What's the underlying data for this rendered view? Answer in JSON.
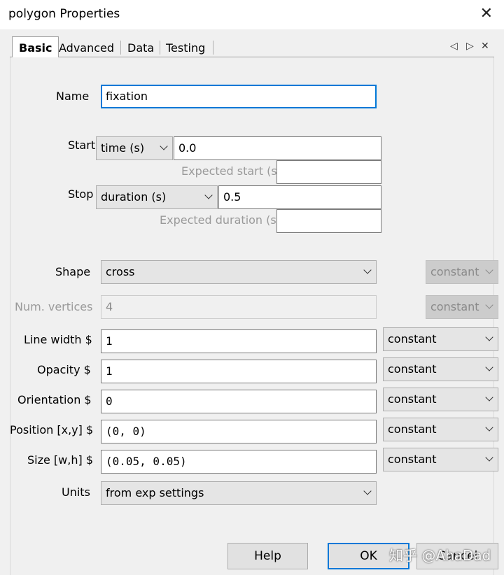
{
  "window": {
    "title": "polygon Properties",
    "close_icon": "close-icon"
  },
  "tabs": [
    {
      "label": "Basic",
      "active": true
    },
    {
      "label": "Advanced"
    },
    {
      "label": "Data"
    },
    {
      "label": "Testing"
    }
  ],
  "tab_nav": {
    "prev": "◁",
    "next": "▷",
    "close": "✕"
  },
  "name": {
    "label": "Name",
    "value": "fixation"
  },
  "start": {
    "label": "Start",
    "type": "time (s)",
    "value": "0.0",
    "expected_label": "Expected start (s)",
    "expected_value": ""
  },
  "stop": {
    "label": "Stop",
    "type": "duration (s)",
    "value": "0.5",
    "expected_label": "Expected duration (s)",
    "expected_value": ""
  },
  "shape": {
    "label": "Shape",
    "value": "cross",
    "update": "constant"
  },
  "num_vertices": {
    "label": "Num. vertices",
    "value": "4",
    "update": "constant"
  },
  "line_width": {
    "label": "Line width $",
    "value": "1",
    "update": "constant"
  },
  "opacity": {
    "label": "Opacity $",
    "value": "1",
    "update": "constant"
  },
  "orientation": {
    "label": "Orientation $",
    "value": "0",
    "update": "constant"
  },
  "position": {
    "label": "Position [x,y] $",
    "value": "(0, 0)",
    "update": "constant"
  },
  "size": {
    "label": "Size [w,h] $",
    "value": "(0.05, 0.05)",
    "update": "constant"
  },
  "units": {
    "label": "Units",
    "value": "from exp settings"
  },
  "buttons": {
    "help": "Help",
    "ok": "OK",
    "cancel": "Cancel"
  },
  "watermark": "知乎 @AhaDad",
  "colors": {
    "accent": "#0078d7",
    "background": "#f0f0f0"
  }
}
